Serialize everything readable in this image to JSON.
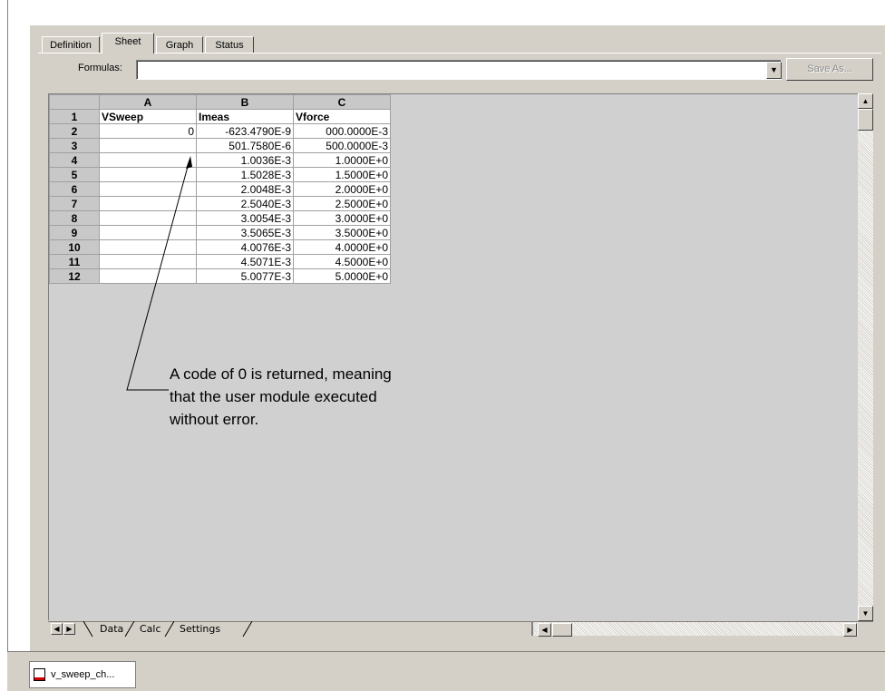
{
  "tabs": [
    "Definition",
    "Sheet",
    "Graph",
    "Status"
  ],
  "formulas": {
    "label": "Formulas:",
    "value": "",
    "save_as": "Save As..."
  },
  "grid": {
    "columns": [
      "A",
      "B",
      "C"
    ],
    "rows": [
      {
        "n": "1",
        "a": "VSweep",
        "b": "Imeas",
        "c": "Vforce"
      },
      {
        "n": "2",
        "a": "0",
        "b": "-623.4790E-9",
        "c": "000.0000E-3"
      },
      {
        "n": "3",
        "a": "",
        "b": "501.7580E-6",
        "c": "500.0000E-3"
      },
      {
        "n": "4",
        "a": "",
        "b": "1.0036E-3",
        "c": "1.0000E+0"
      },
      {
        "n": "5",
        "a": "",
        "b": "1.5028E-3",
        "c": "1.5000E+0"
      },
      {
        "n": "6",
        "a": "",
        "b": "2.0048E-3",
        "c": "2.0000E+0"
      },
      {
        "n": "7",
        "a": "",
        "b": "2.5040E-3",
        "c": "2.5000E+0"
      },
      {
        "n": "8",
        "a": "",
        "b": "3.0054E-3",
        "c": "3.0000E+0"
      },
      {
        "n": "9",
        "a": "",
        "b": "3.5065E-3",
        "c": "3.5000E+0"
      },
      {
        "n": "10",
        "a": "",
        "b": "4.0076E-3",
        "c": "4.0000E+0"
      },
      {
        "n": "11",
        "a": "",
        "b": "4.5071E-3",
        "c": "4.5000E+0"
      },
      {
        "n": "12",
        "a": "",
        "b": "5.0077E-3",
        "c": "5.0000E+0"
      }
    ]
  },
  "sheet_tabs": [
    "Data",
    "Calc",
    "Settings"
  ],
  "annotation": {
    "line1": "A code of 0 is returned, meaning",
    "line2": "that the user module executed",
    "line3": "without error."
  },
  "taskbar": {
    "item": "v_sweep_ch..."
  }
}
